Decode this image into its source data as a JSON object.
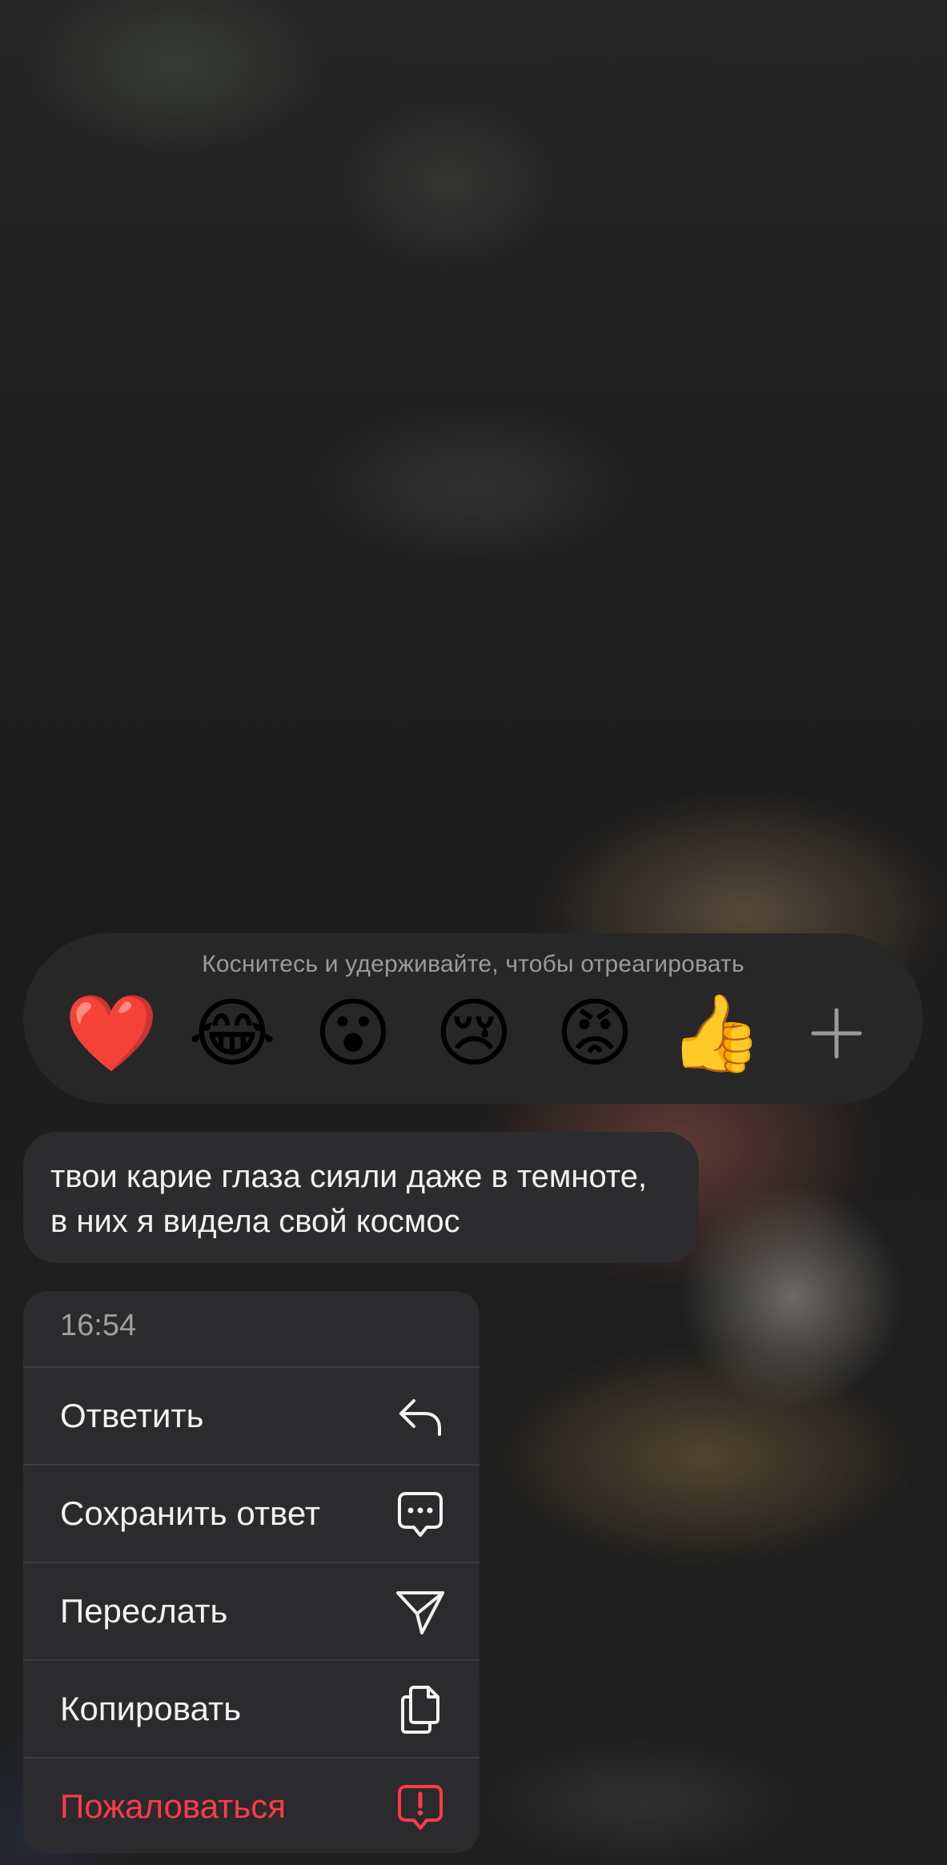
{
  "reactions": {
    "hint": "Коснитесь и удерживайте, чтобы отреагировать",
    "emojis": [
      "❤️",
      "😂",
      "😮",
      "😢",
      "😡",
      "👍"
    ],
    "more_icon": "plus-icon"
  },
  "message": {
    "text": "твои карие глаза сияли даже в темноте, в них я видела свой космос"
  },
  "menu": {
    "time": "16:54",
    "items": [
      {
        "label": "Ответить",
        "icon": "reply-icon"
      },
      {
        "label": "Сохранить ответ",
        "icon": "saved-reply-icon"
      },
      {
        "label": "Переслать",
        "icon": "send-icon"
      },
      {
        "label": "Копировать",
        "icon": "copy-icon"
      },
      {
        "label": "Пожаловаться",
        "icon": "report-icon",
        "color": "#ff3b4a"
      }
    ]
  },
  "colors": {
    "danger": "#ff3b4a",
    "panel": "#2b2b2d",
    "text": "#f2f2f2"
  }
}
